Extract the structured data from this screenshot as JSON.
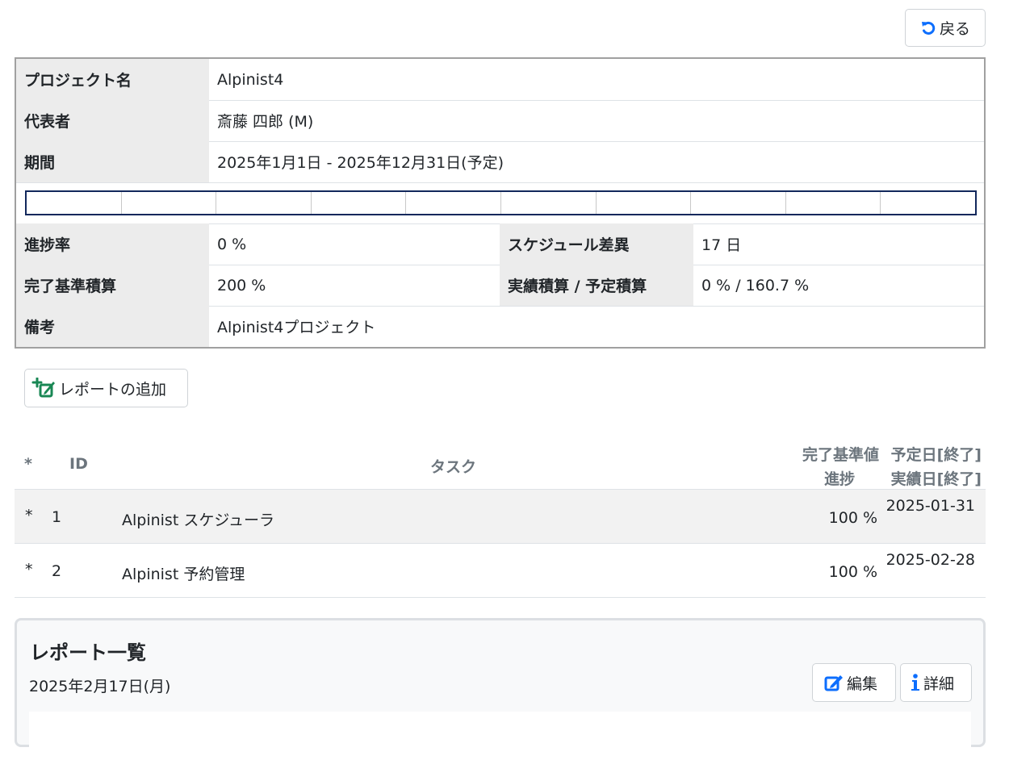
{
  "header": {
    "back_label": "戻る"
  },
  "project": {
    "name_label": "プロジェクト名",
    "name": "Alpinist4",
    "rep_label": "代表者",
    "rep": "斎藤 四郎 (M)",
    "period_label": "期間",
    "period": "2025年1月1日 - 2025年12月31日(予定)",
    "progress_label": "進捗率",
    "progress": "0 %",
    "schedule_diff_label": "スケジュール差異",
    "schedule_diff": "17 日",
    "baseline_label": "完了基準積算",
    "baseline": "200 %",
    "actual_label": "実績積算 / 予定積算",
    "actual": "0 % / 160.7 %",
    "note_label": "備考",
    "note": "Alpinist4プロジェクト",
    "gauge_progress": 0
  },
  "add_report_label": "レポートの追加",
  "tasks": {
    "headers": {
      "star": "*",
      "id": "ID",
      "task": "タスク",
      "baseline": "完了基準値",
      "progress": "進捗",
      "planned": "予定日[終了]",
      "actual": "実績日[終了]"
    },
    "rows": [
      {
        "star": "*",
        "id": "1",
        "name": "Alpinist スケジューラ",
        "progress": "100 %",
        "date": "2025-01-31"
      },
      {
        "star": "*",
        "id": "2",
        "name": "Alpinist 予約管理",
        "progress": "100 %",
        "date": "2025-02-28"
      }
    ]
  },
  "reports": {
    "title": "レポート一覧",
    "date": "2025年2月17日(月)",
    "edit_label": "編集",
    "detail_label": "詳細"
  },
  "colors": {
    "accent": "#0d6efd",
    "add_icon": "#198754",
    "gauge_border": "#12285c"
  }
}
